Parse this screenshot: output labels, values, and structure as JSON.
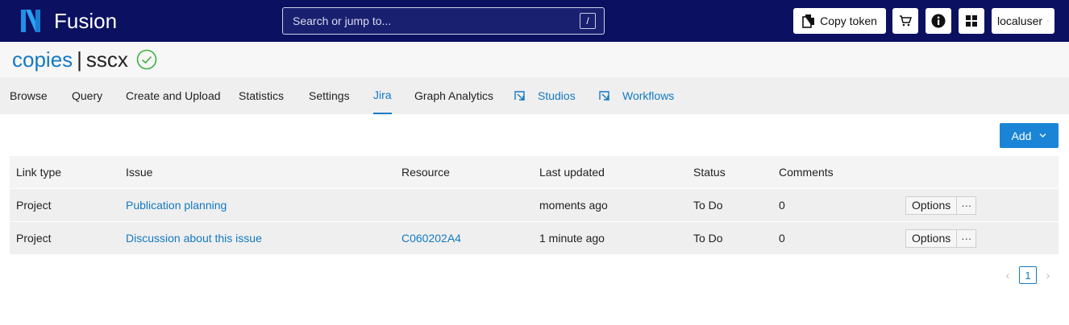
{
  "header": {
    "brand": "Fusion",
    "search_placeholder": "Search or jump to...",
    "search_shortcut": "/",
    "copy_token_label": "Copy token",
    "user_label": "localuser",
    "bg_color": "#0b1160"
  },
  "title": {
    "collection": "copies",
    "separator": "|",
    "name": "sscx"
  },
  "tabs": [
    {
      "label": "Browse"
    },
    {
      "label": "Query"
    },
    {
      "label": "Create and Upload"
    },
    {
      "label": "Statistics"
    },
    {
      "label": "Settings"
    },
    {
      "label": "Jira",
      "active": true
    },
    {
      "label": "Graph Analytics"
    },
    {
      "label": "Studios"
    },
    {
      "label": "Workflows"
    }
  ],
  "toolbar": {
    "add_label": "Add"
  },
  "table": {
    "columns": [
      "Link type",
      "Issue",
      "Resource",
      "Last updated",
      "Status",
      "Comments"
    ],
    "rows": [
      {
        "link_type": "Project",
        "issue": "Publication planning",
        "resource": "",
        "last_updated": "moments ago",
        "status": "To Do",
        "comments": "0"
      },
      {
        "link_type": "Project",
        "issue": "Discussion about this issue",
        "resource": "C060202A4",
        "last_updated": "1 minute ago",
        "status": "To Do",
        "comments": "0"
      }
    ],
    "options_label": "Options",
    "more_label": "···"
  },
  "pagination": {
    "current": "1"
  },
  "colors": {
    "accent": "#1479c3",
    "success": "#3cb043",
    "primary_button": "#1a85d6"
  }
}
